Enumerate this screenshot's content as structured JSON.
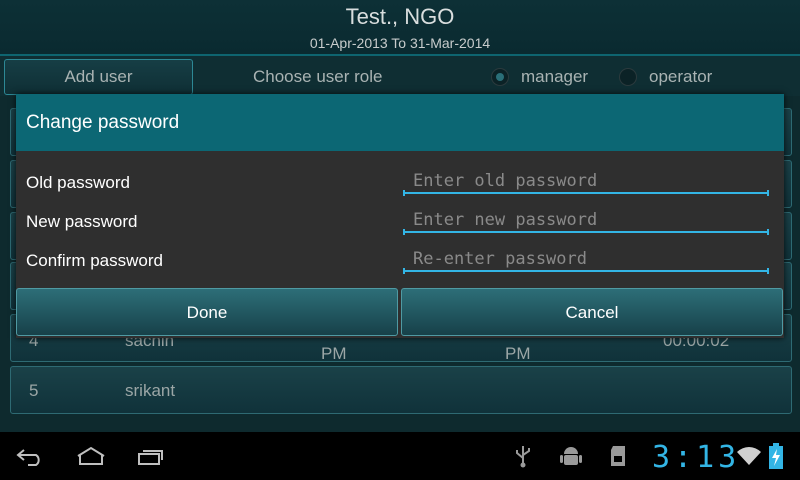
{
  "header": {
    "title": "Test., NGO",
    "subtitle": "01-Apr-2013 To 31-Mar-2014"
  },
  "toolbar": {
    "add_user_label": "Add user",
    "role_label": "Choose user role",
    "roles": [
      {
        "label": "manager",
        "selected": true
      },
      {
        "label": "operator",
        "selected": false
      }
    ]
  },
  "list": {
    "rows": [
      {
        "index": "4",
        "name": "sachin",
        "col3": "PM",
        "col4": "PM",
        "col5": "00:00:02"
      },
      {
        "index": "5",
        "name": "srikant"
      }
    ]
  },
  "dialog": {
    "title": "Change password",
    "fields": [
      {
        "label": "Old password",
        "placeholder": "Enter old password"
      },
      {
        "label": "New password",
        "placeholder": "Enter new password"
      },
      {
        "label": "Confirm password",
        "placeholder": "Re-enter password"
      }
    ],
    "done_label": "Done",
    "cancel_label": "Cancel"
  },
  "statusbar": {
    "time": "3:13",
    "icons": [
      "back-icon",
      "home-icon",
      "recent-apps-icon",
      "usb-icon",
      "android-debug-icon",
      "sd-card-icon",
      "wifi-icon",
      "battery-charging-icon"
    ]
  },
  "colors": {
    "accent": "#33b5e5",
    "dialog_title_bg": "#0c6774",
    "header_bg": "#0d3036"
  }
}
